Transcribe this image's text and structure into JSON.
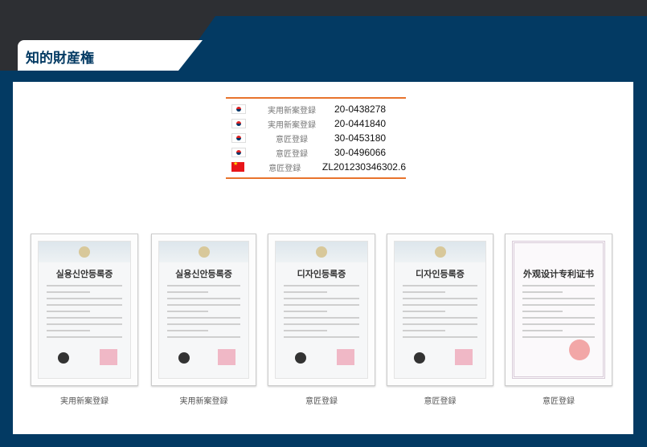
{
  "header": {
    "title": "知的財産権"
  },
  "patents": [
    {
      "flag": "kr",
      "type": "実用新案登録",
      "number": "20-0438278"
    },
    {
      "flag": "kr",
      "type": "実用新案登録",
      "number": "20-0441840"
    },
    {
      "flag": "kr",
      "type": "意匠登録",
      "number": "30-0453180"
    },
    {
      "flag": "kr",
      "type": "意匠登録",
      "number": "30-0496066"
    },
    {
      "flag": "cn",
      "type": "意匠登録",
      "number": "ZL201230346302.6"
    }
  ],
  "certificates": [
    {
      "title": "실용신안등록증",
      "caption": "実用新案登録"
    },
    {
      "title": "실용신안등록증",
      "caption": "実用新案登録"
    },
    {
      "title": "디자인등록증",
      "caption": "意匠登録"
    },
    {
      "title": "디자인등록증",
      "caption": "意匠登録"
    },
    {
      "title": "外观设计专利证书",
      "caption": "意匠登録"
    }
  ]
}
